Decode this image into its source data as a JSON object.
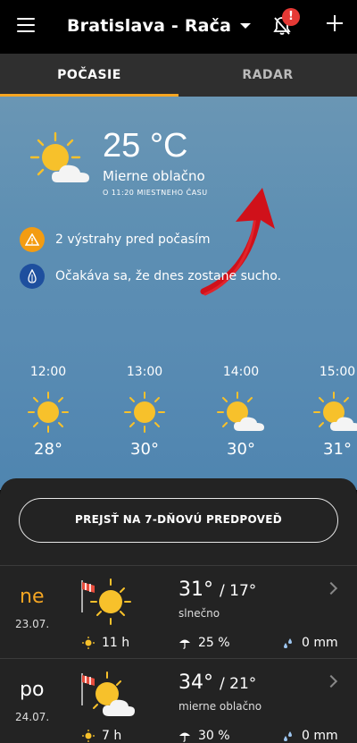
{
  "header": {
    "location": "Bratislava - Rača",
    "notification_badge": "!"
  },
  "tabs": [
    {
      "label": "POČASIE",
      "active": true
    },
    {
      "label": "RADAR",
      "active": false
    }
  ],
  "current": {
    "temperature": "25 °C",
    "condition": "Mierne oblačno",
    "time_note": "O 11:20 MIESTNEHO ČASU",
    "icon": "sun-cloud-icon"
  },
  "alerts": [
    {
      "text": "2 výstrahy pred počasím",
      "icon": "warning-icon",
      "color": "#f39c12"
    },
    {
      "text": "Očakáva sa, že dnes zostane sucho.",
      "icon": "drop-icon",
      "color": "#1e4f9e"
    }
  ],
  "hourly": [
    {
      "time": "12:00",
      "temp": "28°",
      "icon": "sun-icon"
    },
    {
      "time": "13:00",
      "temp": "30°",
      "icon": "sun-icon"
    },
    {
      "time": "14:00",
      "temp": "30°",
      "icon": "sun-cloud-icon"
    },
    {
      "time": "15:00",
      "temp": "31°",
      "icon": "sun-cloud-icon"
    }
  ],
  "forecast_button": "PREJSŤ NA 7-DŇOVÚ PREDPOVEĎ",
  "days": [
    {
      "name": "ne",
      "date": "23.07.",
      "high": "31°",
      "low": "/ 17°",
      "condition": "slnečno",
      "sun_hours": "11 h",
      "rain_chance": "25 %",
      "rain_amount": "0 mm",
      "name_color": "#f5a623",
      "icon": "sun-icon"
    },
    {
      "name": "po",
      "date": "24.07.",
      "high": "34°",
      "low": "/ 21°",
      "condition": "mierne oblačno",
      "sun_hours": "7 h",
      "rain_chance": "30 %",
      "rain_amount": "0 mm",
      "name_color": "#ffffff",
      "icon": "sun-cloud-icon"
    }
  ],
  "colors": {
    "accent": "#f5a623",
    "sun": "#f7c12b",
    "arrow": "#d0111a"
  }
}
